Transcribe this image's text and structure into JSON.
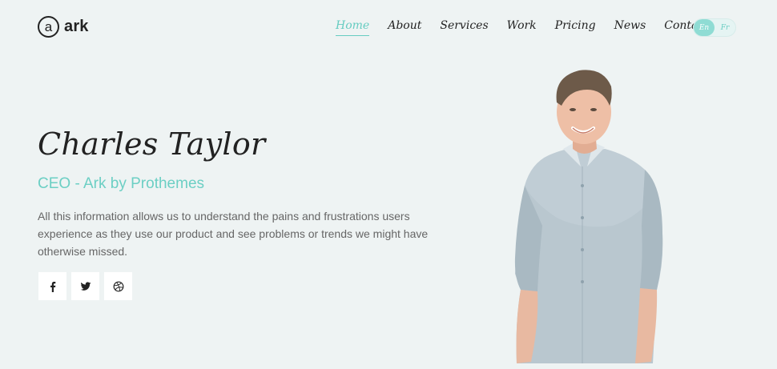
{
  "brand": {
    "logo_letter": "a",
    "name": "ark"
  },
  "nav": {
    "items": [
      {
        "label": "Home",
        "active": true
      },
      {
        "label": "About"
      },
      {
        "label": "Services"
      },
      {
        "label": "Work"
      },
      {
        "label": "Pricing"
      },
      {
        "label": "News"
      },
      {
        "label": "Contacts"
      }
    ]
  },
  "language": {
    "options": [
      "En",
      "Fr"
    ],
    "selected": "En"
  },
  "hero": {
    "name": "Charles Taylor",
    "role": "CEO - Ark by Prothemes",
    "description": "All this information allows us to understand the pains and frustrations users experience as they use our product and see problems or trends we might have otherwise missed."
  },
  "social": [
    {
      "icon": "facebook-icon"
    },
    {
      "icon": "twitter-icon"
    },
    {
      "icon": "dribbble-icon"
    }
  ],
  "colors": {
    "accent": "#66ccc1",
    "background": "#eef3f3",
    "text": "#222222"
  }
}
